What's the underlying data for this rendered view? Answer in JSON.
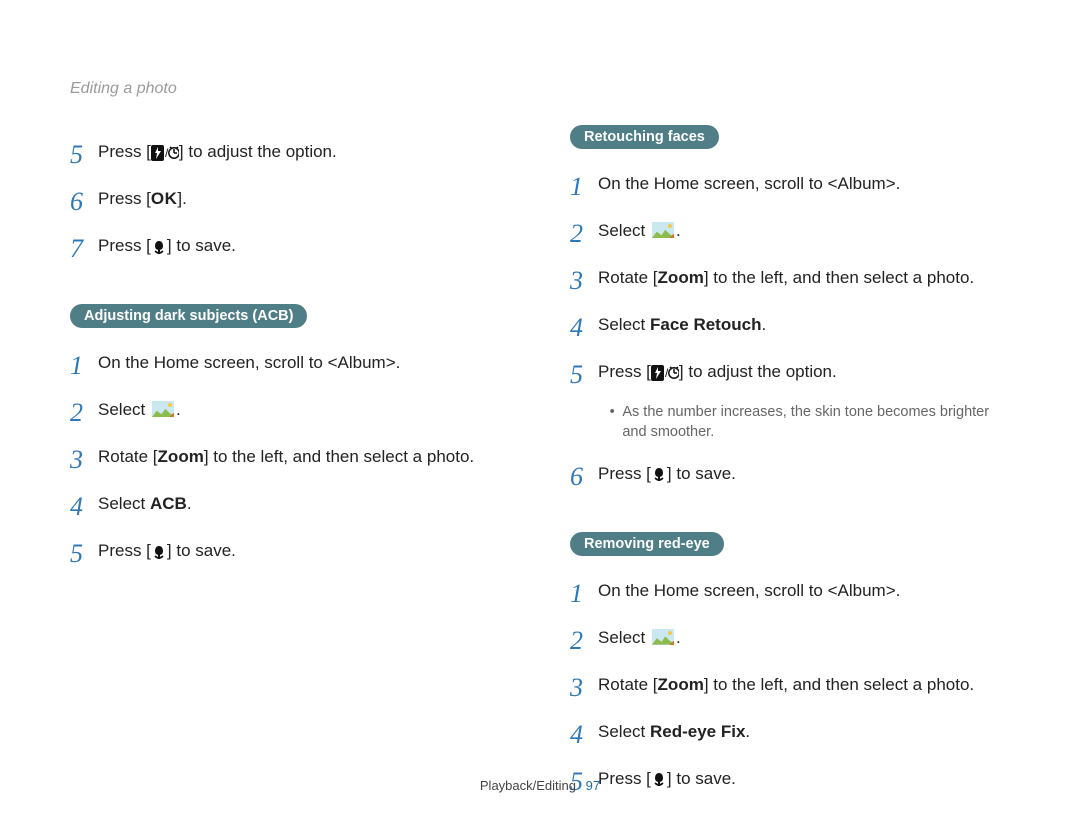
{
  "header": "Editing a photo",
  "footer": {
    "section": "Playback/Editing",
    "page": "97"
  },
  "icons": {
    "flash_timer": "[⚡/⏲]",
    "ok": "OK",
    "macro": "💮"
  },
  "left": {
    "cont": [
      {
        "n": "5",
        "pre": "Press [",
        "icon": "flash_timer",
        "post": "] to adjust the option."
      },
      {
        "n": "6",
        "pre": "Press [",
        "icon": "ok",
        "post": "]."
      },
      {
        "n": "7",
        "pre": "Press [",
        "icon": "macro",
        "post": "] to save."
      }
    ],
    "acb": {
      "title": "Adjusting dark subjects (ACB)",
      "steps": [
        {
          "n": "1",
          "text_pre": "On the Home screen, scroll to ",
          "bold_angle": "<Album>",
          "text_post": "."
        },
        {
          "n": "2",
          "text_pre": "Select ",
          "image_icon": true,
          "text_post": "."
        },
        {
          "n": "3",
          "text_pre": "Rotate [",
          "bold": "Zoom",
          "text_mid": "] to the left, and then select a photo.",
          "text_post": ""
        },
        {
          "n": "4",
          "text_pre": "Select ",
          "bold": "ACB",
          "text_post": "."
        },
        {
          "n": "5",
          "pre": "Press [",
          "icon": "macro",
          "post": "] to save."
        }
      ]
    }
  },
  "right": {
    "retouch": {
      "title": "Retouching faces",
      "steps": [
        {
          "n": "1",
          "text_pre": "On the Home screen, scroll to ",
          "bold_angle": "<Album>",
          "text_post": "."
        },
        {
          "n": "2",
          "text_pre": "Select ",
          "image_icon": true,
          "text_post": "."
        },
        {
          "n": "3",
          "text_pre": "Rotate [",
          "bold": "Zoom",
          "text_mid": "] to the left, and then select a photo.",
          "text_post": ""
        },
        {
          "n": "4",
          "text_pre": "Select ",
          "bold": "Face Retouch",
          "text_post": "."
        },
        {
          "n": "5",
          "pre": "Press [",
          "icon": "flash_timer",
          "post": "] to adjust the option."
        }
      ],
      "note": "As the number increases, the skin tone becomes brighter and smoother.",
      "after": [
        {
          "n": "6",
          "pre": "Press [",
          "icon": "macro",
          "post": "] to save."
        }
      ]
    },
    "redeye": {
      "title": "Removing red-eye",
      "steps": [
        {
          "n": "1",
          "text_pre": "On the Home screen, scroll to ",
          "bold_angle": "<Album>",
          "text_post": "."
        },
        {
          "n": "2",
          "text_pre": "Select ",
          "image_icon": true,
          "text_post": "."
        },
        {
          "n": "3",
          "text_pre": "Rotate [",
          "bold": "Zoom",
          "text_mid": "] to the left, and then select a photo.",
          "text_post": ""
        },
        {
          "n": "4",
          "text_pre": "Select ",
          "bold": "Red-eye Fix",
          "text_post": "."
        },
        {
          "n": "5",
          "pre": "Press [",
          "icon": "macro",
          "post": "] to save."
        }
      ]
    }
  }
}
